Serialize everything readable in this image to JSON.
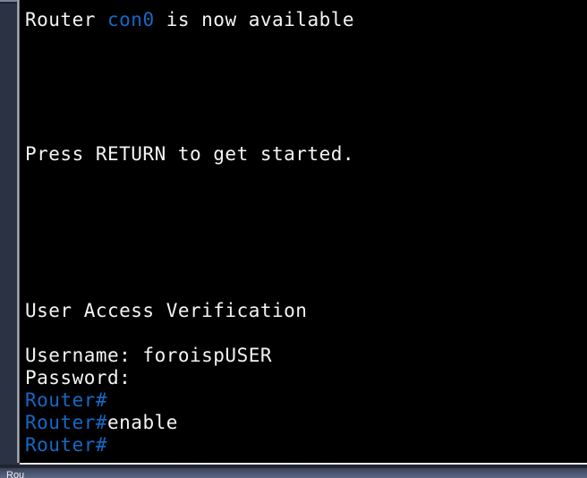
{
  "window": {
    "background_color": "#000000",
    "dock_color": "#2b3244",
    "accent_blue": "#1569c7",
    "text_color": "#f4f4f4"
  },
  "terminal": {
    "name": "cisco-router-console",
    "lines": [
      {
        "id": "line-console-available",
        "segments": [
          {
            "text": "Router ",
            "color": "white"
          },
          {
            "text": "con0",
            "color": "blue"
          },
          {
            "text": " is now available",
            "color": "white"
          }
        ],
        "plain": "Router con0 is now available"
      },
      {
        "id": "line-blank-1",
        "segments": [],
        "plain": ""
      },
      {
        "id": "line-blank-2",
        "segments": [],
        "plain": ""
      },
      {
        "id": "line-blank-3",
        "segments": [],
        "plain": ""
      },
      {
        "id": "line-blank-4",
        "segments": [],
        "plain": ""
      },
      {
        "id": "line-blank-5",
        "segments": [],
        "plain": ""
      },
      {
        "id": "line-press-return",
        "segments": [
          {
            "text": "Press RETURN to get started.",
            "color": "white"
          }
        ],
        "plain": "Press RETURN to get started."
      },
      {
        "id": "line-blank-6",
        "segments": [],
        "plain": ""
      },
      {
        "id": "line-blank-7",
        "segments": [],
        "plain": ""
      },
      {
        "id": "line-blank-8",
        "segments": [],
        "plain": ""
      },
      {
        "id": "line-blank-9",
        "segments": [],
        "plain": ""
      },
      {
        "id": "line-blank-10",
        "segments": [],
        "plain": ""
      },
      {
        "id": "line-blank-11",
        "segments": [],
        "plain": ""
      },
      {
        "id": "line-user-access-verification",
        "segments": [
          {
            "text": "User Access Verification",
            "color": "white"
          }
        ],
        "plain": "User Access Verification"
      },
      {
        "id": "line-blank-12",
        "segments": [],
        "plain": ""
      },
      {
        "id": "line-username",
        "segments": [
          {
            "text": "Username: foroispUSER",
            "color": "white"
          }
        ],
        "plain": "Username: foroispUSER"
      },
      {
        "id": "line-password",
        "segments": [
          {
            "text": "Password:",
            "color": "white"
          }
        ],
        "plain": "Password:"
      },
      {
        "id": "line-prompt-1",
        "segments": [
          {
            "text": "Router#",
            "color": "blue"
          }
        ],
        "plain": "Router#"
      },
      {
        "id": "line-prompt-enable",
        "segments": [
          {
            "text": "Router#",
            "color": "blue"
          },
          {
            "text": "enable",
            "color": "white"
          }
        ],
        "plain": "Router#enable"
      },
      {
        "id": "line-prompt-2",
        "segments": [
          {
            "text": "Router#",
            "color": "blue"
          }
        ],
        "plain": "Router#"
      }
    ]
  },
  "taskbar": {
    "clipped_label": "Rou"
  }
}
